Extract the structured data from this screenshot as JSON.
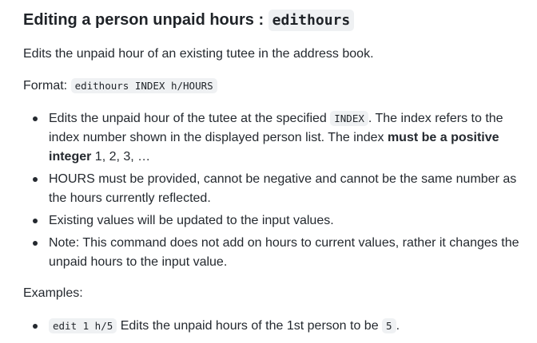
{
  "heading": {
    "text": "Editing a person unpaid hours : ",
    "code": "edithours"
  },
  "intro": "Edits the unpaid hour of an existing tutee in the address book.",
  "format": {
    "label": "Format: ",
    "code": "edithours INDEX h/HOURS"
  },
  "bullets": {
    "b1": {
      "part1": "Edits the unpaid hour of the tutee at the specified ",
      "code": "INDEX",
      "part2": ". The index refers to the index number shown in the displayed person list. The index ",
      "bold": "must be a positive integer",
      "part3": " 1, 2, 3, …"
    },
    "b2": "HOURS must be provided, cannot be negative and cannot be the same number as the hours currently reflected.",
    "b3": "Existing values will be updated to the input values.",
    "b4": "Note: This command does not add on hours to current values, rather it changes the unpaid hours to the input value."
  },
  "examples": {
    "label": "Examples:",
    "e1": {
      "code": "edit 1 h/5",
      "text": " Edits the unpaid hours of the 1st person to be ",
      "value": "5",
      "end": "."
    }
  }
}
